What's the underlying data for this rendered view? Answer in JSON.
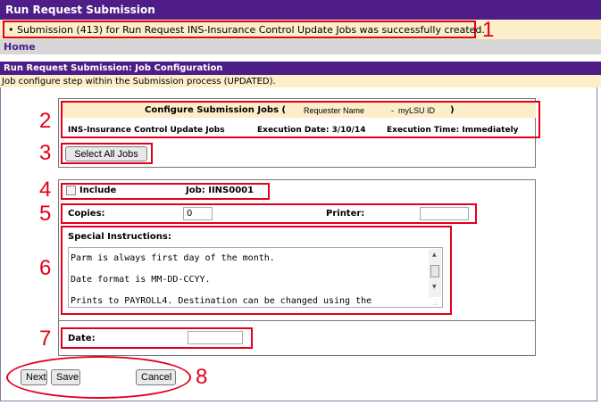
{
  "page": {
    "title": "Run Request Submission"
  },
  "notice": {
    "message": "• Submission (413) for Run Request INS-Insurance Control Update Jobs was successfully created."
  },
  "nav": {
    "home": "Home"
  },
  "section": {
    "title": "Run Request Submission: Job Configuration",
    "subtitle": "Job configure step within the Submission process (UPDATED)."
  },
  "configure": {
    "heading": "Configure Submission Jobs (",
    "requester_label": "Requester Name",
    "id_sep": "-  myLSU ID",
    "close_paren": ")",
    "run_request": "INS-Insurance Control Update Jobs",
    "exec_date": "Execution Date: 3/10/14",
    "exec_time": "Execution Time: Immediately",
    "select_all": "Select All Jobs"
  },
  "job": {
    "include_label": "Include",
    "job_label": "Job: IINS0001",
    "copies_label": "Copies:",
    "copies_value": "0",
    "printer_label": "Printer:",
    "printer_value": "",
    "special_label": "Special Instructions:",
    "special_lines": [
      "Parm is always first day of the month.",
      "Date format is MM-DD-CCYY.",
      "Prints to PAYROLL4. Destination can be changed using the"
    ],
    "date_label": "Date:",
    "date_value": ""
  },
  "actions": {
    "next": "Next",
    "save": "Save",
    "cancel": "Cancel"
  },
  "callouts": [
    "1",
    "2",
    "3",
    "4",
    "5",
    "6",
    "7",
    "8"
  ],
  "colors": {
    "header": "#4f1d87",
    "notice": "#fbeec9",
    "callout": "#e3001b"
  }
}
